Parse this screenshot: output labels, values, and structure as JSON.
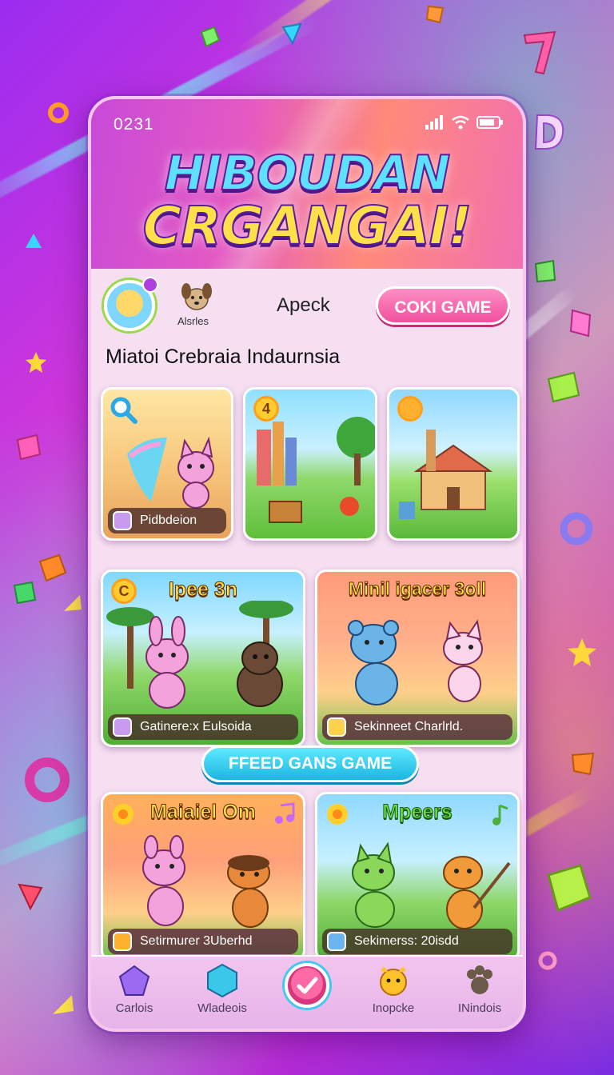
{
  "status": {
    "time": "0231"
  },
  "header": {
    "title_line1": "HIBOUDAN",
    "title_line2": "CRGANGAI!"
  },
  "profile": {
    "pet_label": "Alsrles",
    "center_label": "Apeck",
    "top_button_label": "COKI GAME"
  },
  "section_heading": "Miatoi Crebraia Indaurnsia",
  "row1_cards": [
    {
      "label": "Pidbdeion"
    },
    {
      "badge": "4"
    },
    {
      "badge": ""
    }
  ],
  "row2_cards": [
    {
      "title": "Ipee 3n",
      "badge": "C",
      "label": "Gatinere:x Eulsoida"
    },
    {
      "title": "Minil igacer 3oll",
      "label": "Sekinneet Charlrld."
    }
  ],
  "mid_button_label": "FFEED GANS GAME",
  "row3_cards": [
    {
      "title": "Maiaiel Om",
      "label": "Setirmurer 3Uberhd"
    },
    {
      "title": "Mpeers",
      "label": "Sekimerss: 20isdd"
    }
  ],
  "nav": {
    "items": [
      {
        "label": "Carlois",
        "icon": "pentagon-icon"
      },
      {
        "label": "Wladeois",
        "icon": "gem-icon"
      },
      {
        "label": "",
        "icon": "check-icon"
      },
      {
        "label": "Inopcke",
        "icon": "star-face-icon"
      },
      {
        "label": "INindois",
        "icon": "paw-icon"
      }
    ]
  }
}
